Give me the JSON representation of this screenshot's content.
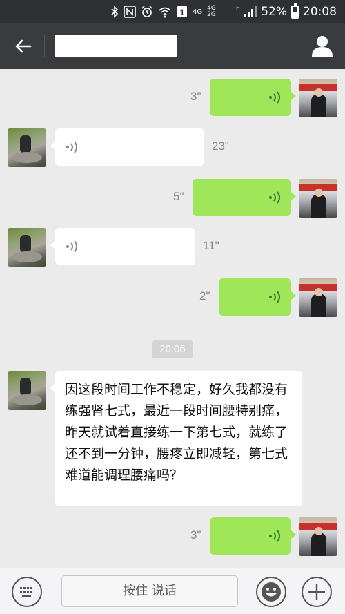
{
  "status_bar": {
    "network_label": "4G",
    "network_label_2": "4G 2G",
    "signal_letter": "E",
    "battery": "52%",
    "battery_level": 0.52,
    "time": "20:08"
  },
  "header": {
    "title": ""
  },
  "messages": [
    {
      "side": "right",
      "type": "voice",
      "duration": "3\""
    },
    {
      "side": "left",
      "type": "voice",
      "duration": "23\""
    },
    {
      "side": "right",
      "type": "voice",
      "duration": "5\""
    },
    {
      "side": "left",
      "type": "voice",
      "duration": "11\""
    },
    {
      "side": "right",
      "type": "voice",
      "duration": "2\""
    },
    {
      "side": "center",
      "type": "timestamp",
      "text": "20:06"
    },
    {
      "side": "left",
      "type": "text",
      "text": "因这段时间工作不稳定，好久我都没有练强肾七式，最近一段时间腰特别痛，昨天就试着直接练一下第七式，就练了还不到一分钟，腰疼立即减轻，第七式难道能调理腰痛吗？"
    },
    {
      "side": "right",
      "type": "voice",
      "duration": "3\""
    }
  ],
  "input_bar": {
    "hold_to_talk": "按住 说话"
  },
  "colors": {
    "status_bar_bg": "#2f3033",
    "title_bar_bg": "#3a3b3e",
    "chat_bg": "#ebebeb",
    "outgoing_bubble": "#9fe658",
    "incoming_bubble": "#ffffff"
  }
}
